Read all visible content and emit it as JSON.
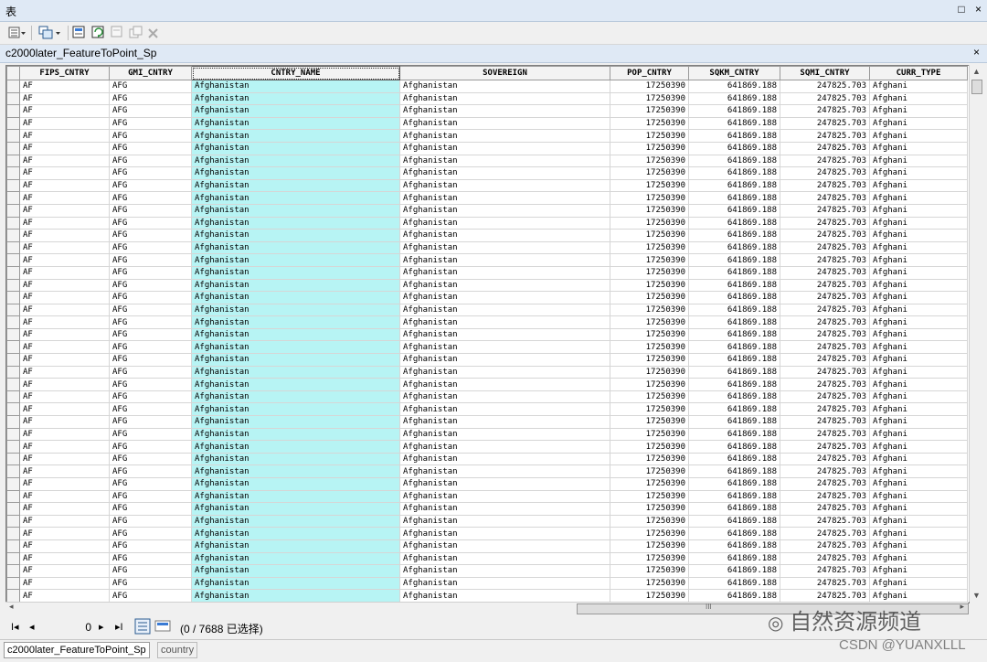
{
  "window": {
    "title": "表",
    "controls": [
      "□",
      "×"
    ]
  },
  "table_tab": {
    "title": "c2000later_FeatureToPoint_Sp",
    "close": "×"
  },
  "columns": [
    "FIPS_CNTRY",
    "GMI_CNTRY",
    "CNTRY_NAME",
    "SOVEREIGN",
    "POP_CNTRY",
    "SQKM_CNTRY",
    "SQMI_CNTRY",
    "CURR_TYPE"
  ],
  "row_template": [
    "AF",
    "AFG",
    "Afghanistan",
    "Afghanistan",
    "17250390",
    "641869.188",
    "247825.703",
    "Afghani"
  ],
  "row_count": 42,
  "status": {
    "record": "0",
    "selected": "(0 / 7688 已选择)"
  },
  "bottom_tabs": [
    "c2000later_FeatureToPoint_Sp",
    "country"
  ],
  "scroll_arrows": {
    "left": "◂",
    "right": "▸",
    "up": "▲",
    "down": "▼",
    "grip": "III"
  },
  "nav": {
    "first": "I◂",
    "prev": "◂",
    "next": "▸",
    "last": "▸I"
  },
  "watermark": {
    "logo": "自然资源频道",
    "credit": "CSDN @YUANXLLL"
  },
  "colors": {
    "selected_column": "#b7f4f4",
    "title_bg": "#dfe9f5"
  }
}
